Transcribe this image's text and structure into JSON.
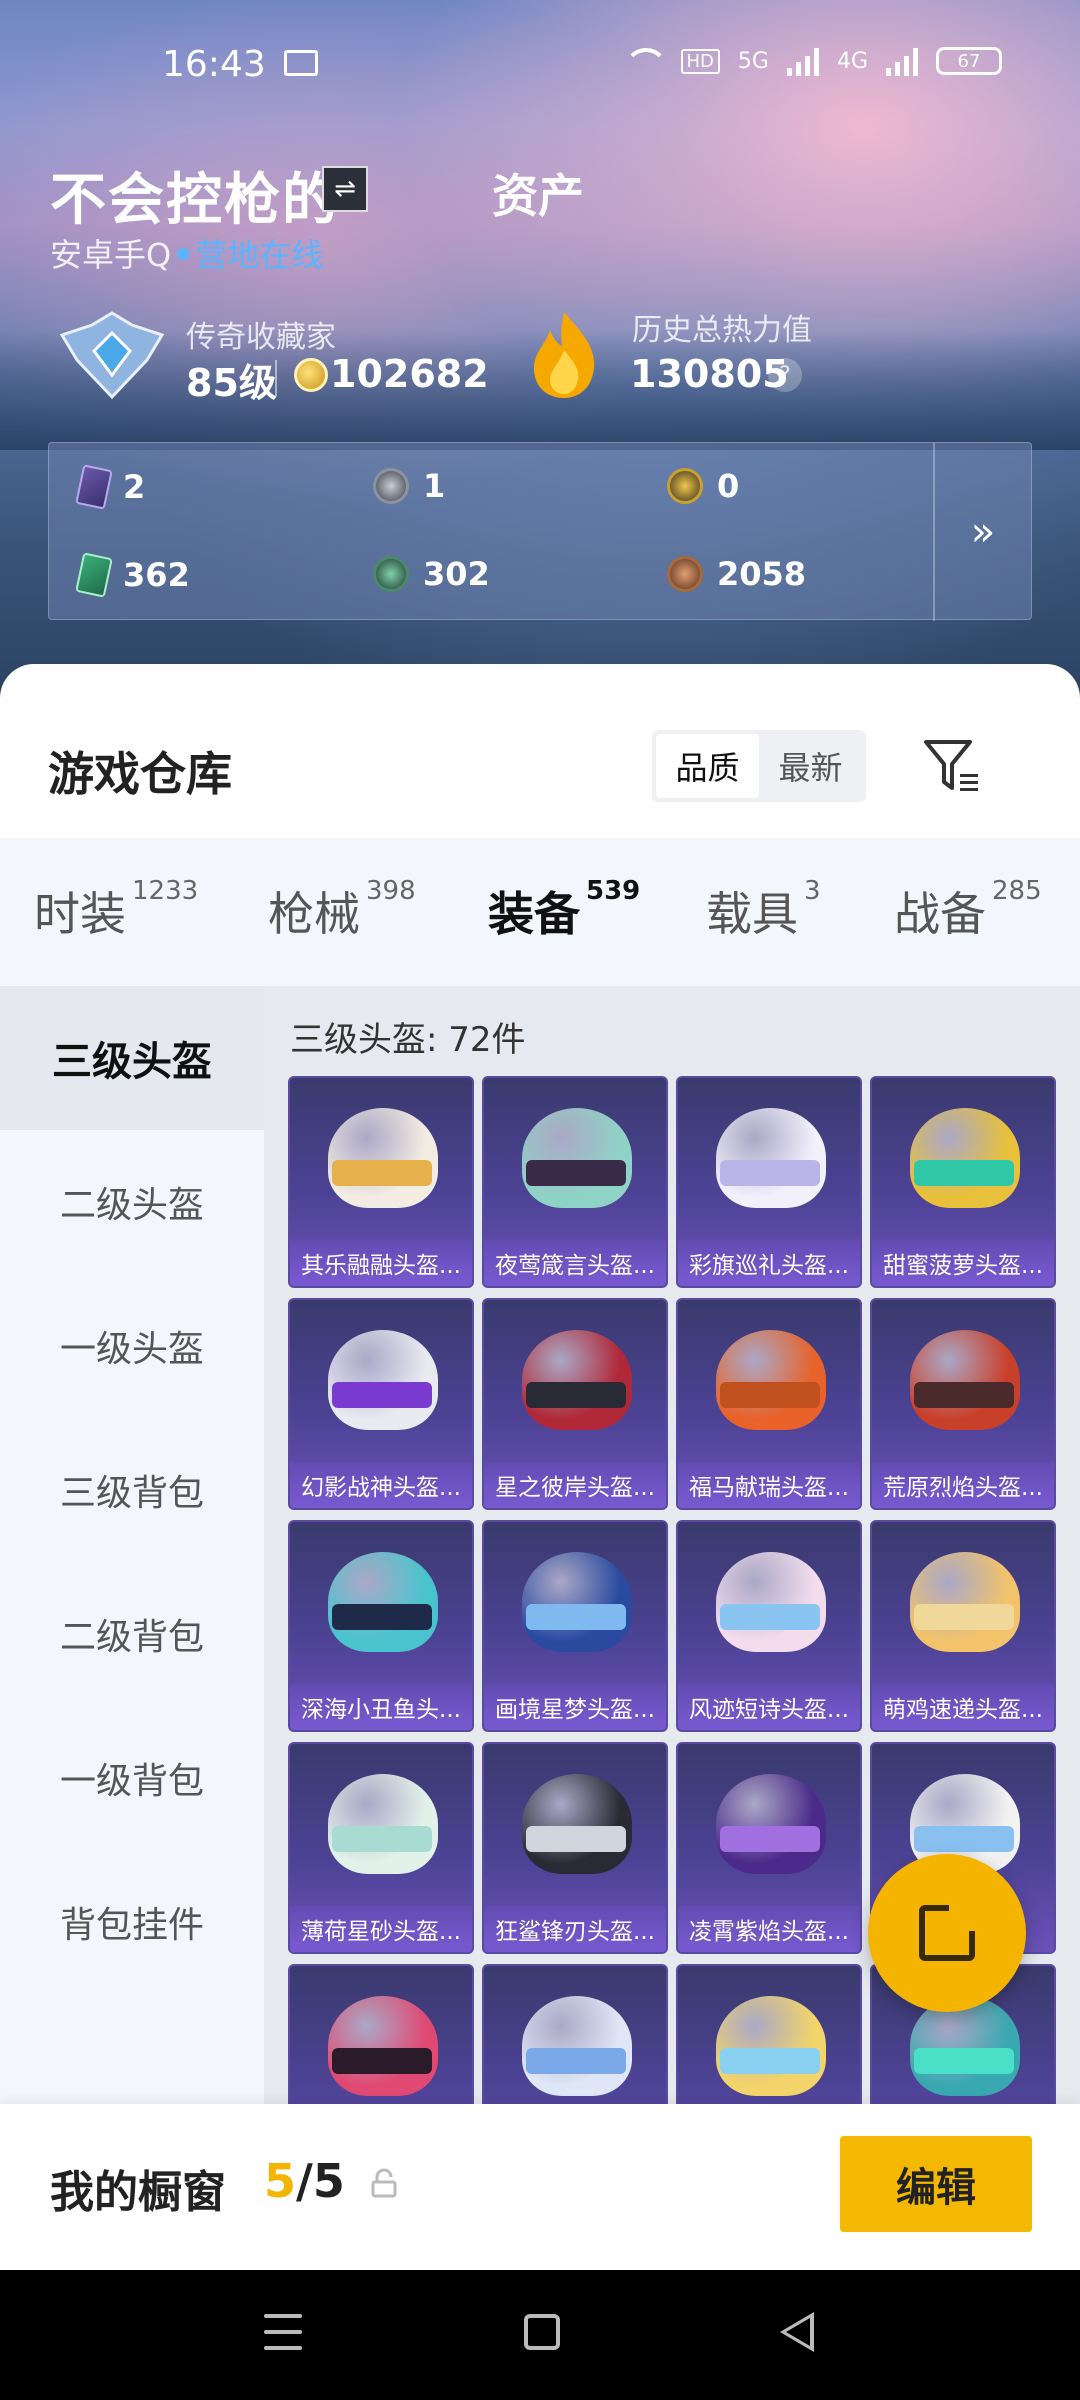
{
  "status_bar": {
    "time": "16:43",
    "hd_label": "HD",
    "net1": "5G",
    "net2": "4G",
    "battery": "67"
  },
  "profile": {
    "name": "不会控枪的",
    "assets_tab": "资产",
    "device": "安卓手Q",
    "status": "营地在线",
    "rank_title": "传奇收藏家",
    "level": "85级",
    "coins": "102682",
    "heat_title": "历史总热力值",
    "heat_value": "130805",
    "help_label": "?"
  },
  "item_counts": [
    {
      "icon": "purple-card-icon",
      "value": "2"
    },
    {
      "icon": "silver-medal-icon",
      "value": "1"
    },
    {
      "icon": "gold-medal-icon",
      "value": "0"
    },
    {
      "icon": "green-card-icon",
      "value": "362"
    },
    {
      "icon": "green-coin-icon",
      "value": "302"
    },
    {
      "icon": "bronze-coin-icon",
      "value": "2058"
    }
  ],
  "more_label": "»",
  "warehouse": {
    "title": "游戏仓库",
    "sort_options": [
      "品质",
      "最新"
    ],
    "sort_selected": "品质"
  },
  "category_tabs": [
    {
      "label": "时装",
      "count": "1233"
    },
    {
      "label": "枪械",
      "count": "398"
    },
    {
      "label": "装备",
      "count": "539",
      "active": true
    },
    {
      "label": "载具",
      "count": "3"
    },
    {
      "label": "战备",
      "count": "285"
    }
  ],
  "side_menu": [
    "三级头盔",
    "二级头盔",
    "一级头盔",
    "三级背包",
    "二级背包",
    "一级背包",
    "背包挂件"
  ],
  "section_title": "三级头盔: 72件",
  "items": [
    {
      "label": "其乐融融头盔...",
      "helm": "#f3ece2",
      "visor": "#e6b04a"
    },
    {
      "label": "夜莺箴言头盔...",
      "helm": "#8fd2c6",
      "visor": "#3a2a4a"
    },
    {
      "label": "彩旗巡礼头盔...",
      "helm": "#f2f0fb",
      "visor": "#b9b5e8"
    },
    {
      "label": "甜蜜菠萝头盔...",
      "helm": "#e8c03a",
      "visor": "#2fc9a8"
    },
    {
      "label": "幻影战神头盔...",
      "helm": "#e9e9f0",
      "visor": "#7a3ad0"
    },
    {
      "label": "星之彼岸头盔...",
      "helm": "#b02838",
      "visor": "#2a2a36"
    },
    {
      "label": "福马献瑞头盔...",
      "helm": "#e8622a",
      "visor": "#c0501e"
    },
    {
      "label": "荒原烈焰头盔...",
      "helm": "#c9402a",
      "visor": "#4a2a2a"
    },
    {
      "label": "深海小丑鱼头...",
      "helm": "#49c4cf",
      "visor": "#1f2a48"
    },
    {
      "label": "画境星梦头盔...",
      "helm": "#2a4aa0",
      "visor": "#7fb9f0"
    },
    {
      "label": "风迹短诗头盔...",
      "helm": "#f2dced",
      "visor": "#8ac4f0"
    },
    {
      "label": "萌鸡速递头盔...",
      "helm": "#f2c36a",
      "visor": "#f0d89a"
    },
    {
      "label": "薄荷星砂头盔...",
      "helm": "#e2f2ea",
      "visor": "#a8dcd2"
    },
    {
      "label": "狂鲨锋刃头盔...",
      "helm": "#2a2a34",
      "visor": "#d0d4dc"
    },
    {
      "label": "凌霄紫焰头盔...",
      "helm": "#4a2a8a",
      "visor": "#a070e0"
    },
    {
      "label": "",
      "helm": "#f2f2f2",
      "visor": "#8ac0f0"
    },
    {
      "label": "",
      "helm": "#e04a72",
      "visor": "#2a1a2a"
    },
    {
      "label": "",
      "helm": "#dfe6f5",
      "visor": "#7aa8e8"
    },
    {
      "label": "",
      "helm": "#f2d46a",
      "visor": "#8ad0f0"
    },
    {
      "label": "",
      "helm": "#3aa8b0",
      "visor": "#4ae0c8"
    }
  ],
  "showcase": {
    "title": "我的橱窗",
    "count_current": "5",
    "count_sep": "/",
    "count_total": "5",
    "edit_label": "编辑"
  },
  "colors": {
    "accent": "#f5b800",
    "online": "#5ab4ff"
  }
}
